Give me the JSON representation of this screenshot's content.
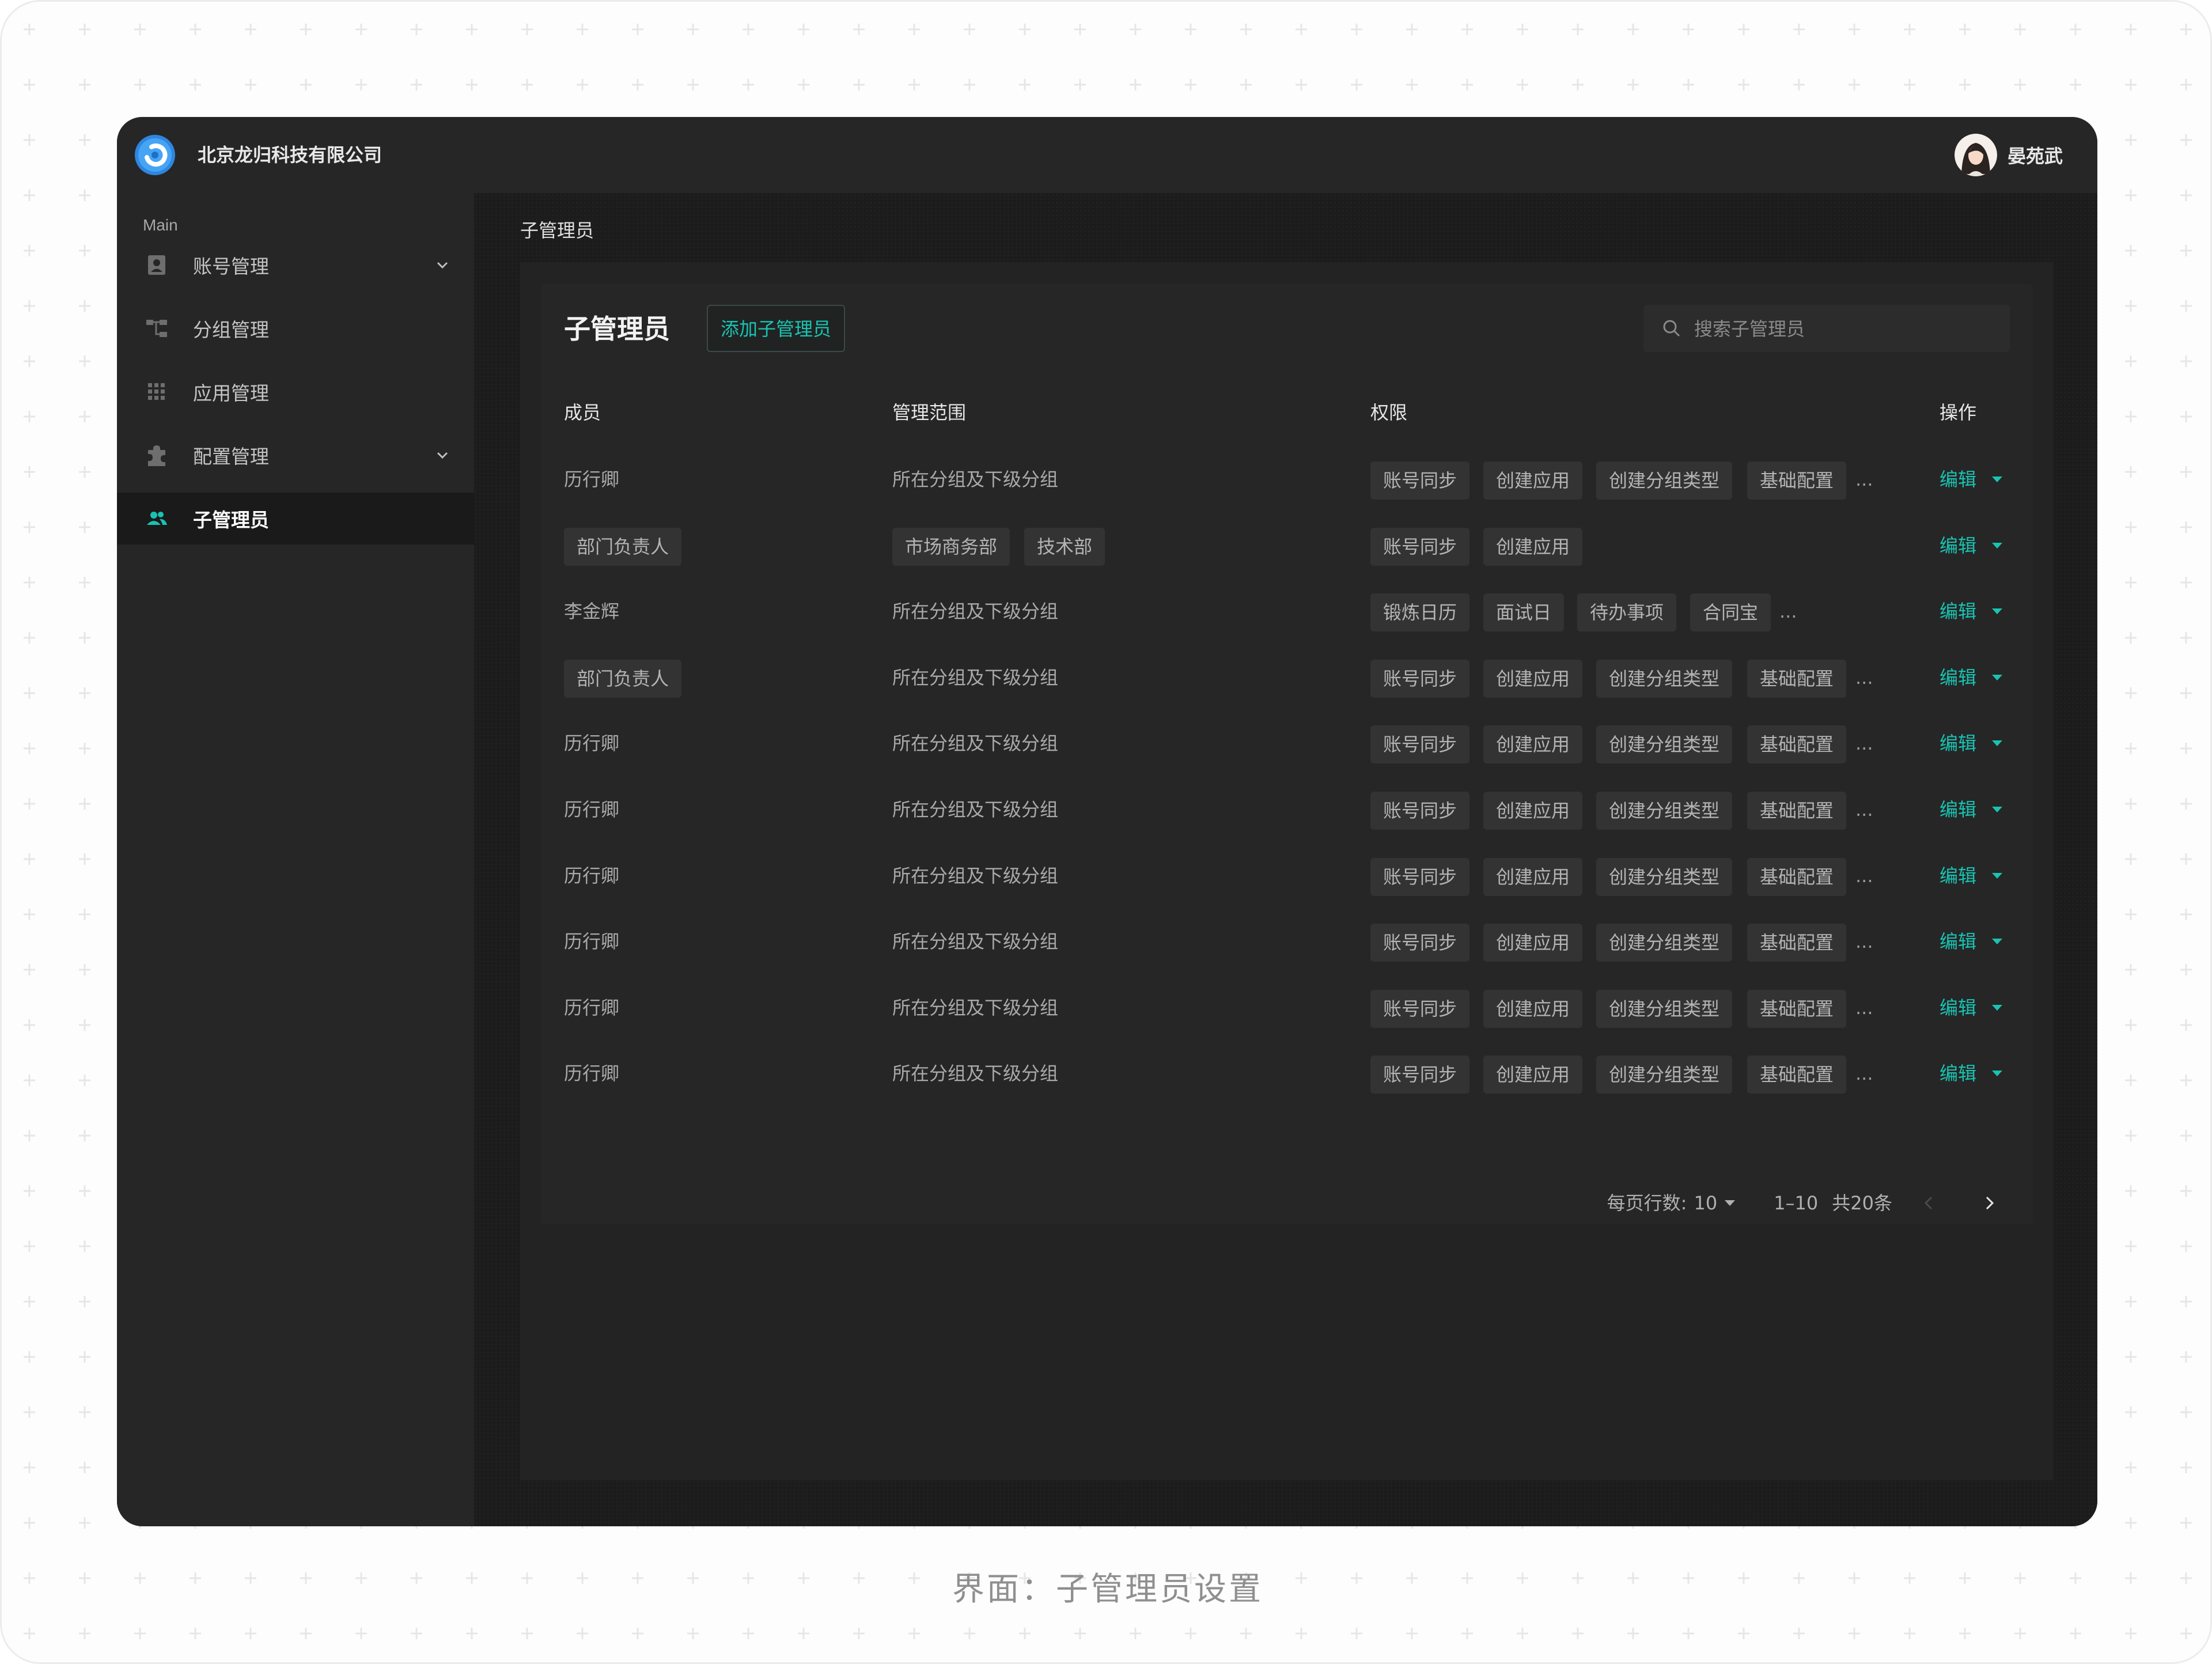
{
  "app": {
    "company": "北京龙归科技有限公司",
    "user": "晏苑武"
  },
  "sidebar": {
    "section": "Main",
    "items": [
      {
        "label": "账号管理",
        "icon": "contact-card-icon",
        "has_chevron": true
      },
      {
        "label": "分组管理",
        "icon": "tree-structure-icon",
        "has_chevron": false
      },
      {
        "label": "应用管理",
        "icon": "grid-apps-icon",
        "has_chevron": false
      },
      {
        "label": "配置管理",
        "icon": "puzzle-icon",
        "has_chevron": true
      },
      {
        "label": "子管理员",
        "icon": "users-icon",
        "has_chevron": false,
        "active": true
      }
    ]
  },
  "breadcrumb": "子管理员",
  "main": {
    "title": "子管理员",
    "add_button": "添加子管理员",
    "search_placeholder": "搜索子管理员",
    "columns": [
      "成员",
      "管理范围",
      "权限",
      "操作"
    ],
    "rows": [
      {
        "member": "历行卿",
        "member_chip": false,
        "scope": [
          "所在分组及下级分组"
        ],
        "scope_chip": false,
        "perms": [
          "账号同步",
          "创建应用",
          "创建分组类型",
          "基础配置"
        ],
        "more": true,
        "action": "编辑"
      },
      {
        "member": "部门负责人",
        "member_chip": true,
        "scope": [
          "市场商务部",
          "技术部"
        ],
        "scope_chip": true,
        "perms": [
          "账号同步",
          "创建应用"
        ],
        "more": false,
        "action": "编辑"
      },
      {
        "member": "李金辉",
        "member_chip": false,
        "scope": [
          "所在分组及下级分组"
        ],
        "scope_chip": false,
        "perms": [
          "锻炼日历",
          "面试日",
          "待办事项",
          "合同宝"
        ],
        "more": true,
        "action": "编辑"
      },
      {
        "member": "部门负责人",
        "member_chip": true,
        "scope": [
          "所在分组及下级分组"
        ],
        "scope_chip": false,
        "perms": [
          "账号同步",
          "创建应用",
          "创建分组类型",
          "基础配置"
        ],
        "more": true,
        "action": "编辑"
      },
      {
        "member": "历行卿",
        "member_chip": false,
        "scope": [
          "所在分组及下级分组"
        ],
        "scope_chip": false,
        "perms": [
          "账号同步",
          "创建应用",
          "创建分组类型",
          "基础配置"
        ],
        "more": true,
        "action": "编辑"
      },
      {
        "member": "历行卿",
        "member_chip": false,
        "scope": [
          "所在分组及下级分组"
        ],
        "scope_chip": false,
        "perms": [
          "账号同步",
          "创建应用",
          "创建分组类型",
          "基础配置"
        ],
        "more": true,
        "action": "编辑"
      },
      {
        "member": "历行卿",
        "member_chip": false,
        "scope": [
          "所在分组及下级分组"
        ],
        "scope_chip": false,
        "perms": [
          "账号同步",
          "创建应用",
          "创建分组类型",
          "基础配置"
        ],
        "more": true,
        "action": "编辑"
      },
      {
        "member": "历行卿",
        "member_chip": false,
        "scope": [
          "所在分组及下级分组"
        ],
        "scope_chip": false,
        "perms": [
          "账号同步",
          "创建应用",
          "创建分组类型",
          "基础配置"
        ],
        "more": true,
        "action": "编辑"
      },
      {
        "member": "历行卿",
        "member_chip": false,
        "scope": [
          "所在分组及下级分组"
        ],
        "scope_chip": false,
        "perms": [
          "账号同步",
          "创建应用",
          "创建分组类型",
          "基础配置"
        ],
        "more": true,
        "action": "编辑"
      },
      {
        "member": "历行卿",
        "member_chip": false,
        "scope": [
          "所在分组及下级分组"
        ],
        "scope_chip": false,
        "perms": [
          "账号同步",
          "创建应用",
          "创建分组类型",
          "基础配置"
        ],
        "more": true,
        "action": "编辑"
      }
    ],
    "more_symbol": "...",
    "pagination": {
      "rows_label": "每页行数:",
      "rows_value": "10",
      "range": "1–10",
      "total": "共20条"
    }
  },
  "caption": "界面：子管理员设置",
  "colors": {
    "accent": "#19c3b2",
    "window_bg": "#1e1e1e",
    "panel_bg": "#262626",
    "chip_bg": "#333333"
  }
}
